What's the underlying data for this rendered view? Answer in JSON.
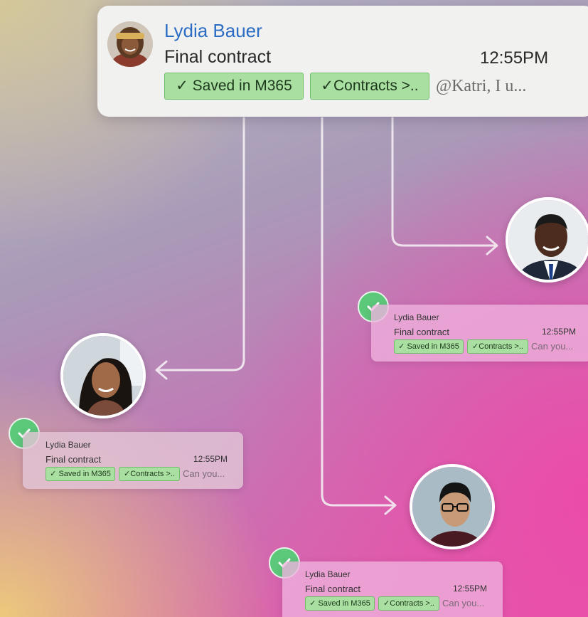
{
  "main_message": {
    "sender": "Lydia Bauer",
    "subject": "Final contract",
    "time": "12:55PM",
    "tags": [
      "✓ Saved in M365",
      "✓Contracts >.."
    ],
    "preview": "@Katri, I u..."
  },
  "notifications": [
    {
      "sender": "Lydia Bauer",
      "subject": "Final contract",
      "time": "12:55PM",
      "tags": [
        "✓ Saved in M365",
        "✓Contracts >.."
      ],
      "preview": "Can you..."
    },
    {
      "sender": "Lydia Bauer",
      "subject": "Final contract",
      "time": "12:55PM",
      "tags": [
        "✓ Saved in M365",
        "✓Contracts >.."
      ],
      "preview": "Can you..."
    },
    {
      "sender": "Lydia Bauer",
      "subject": "Final contract",
      "time": "12:55PM",
      "tags": [
        "✓ Saved in M365",
        "✓Contracts >.."
      ],
      "preview": "Can you..."
    }
  ],
  "colors": {
    "accent_name": "#2b6dc4",
    "tag_fill": "#a9dfa0",
    "tag_border": "#6fbd6a",
    "check_badge": "#5cc87a",
    "connector": "#f2eef3"
  },
  "icons": {
    "check": "check-icon",
    "arrow": "arrow-right-icon"
  }
}
